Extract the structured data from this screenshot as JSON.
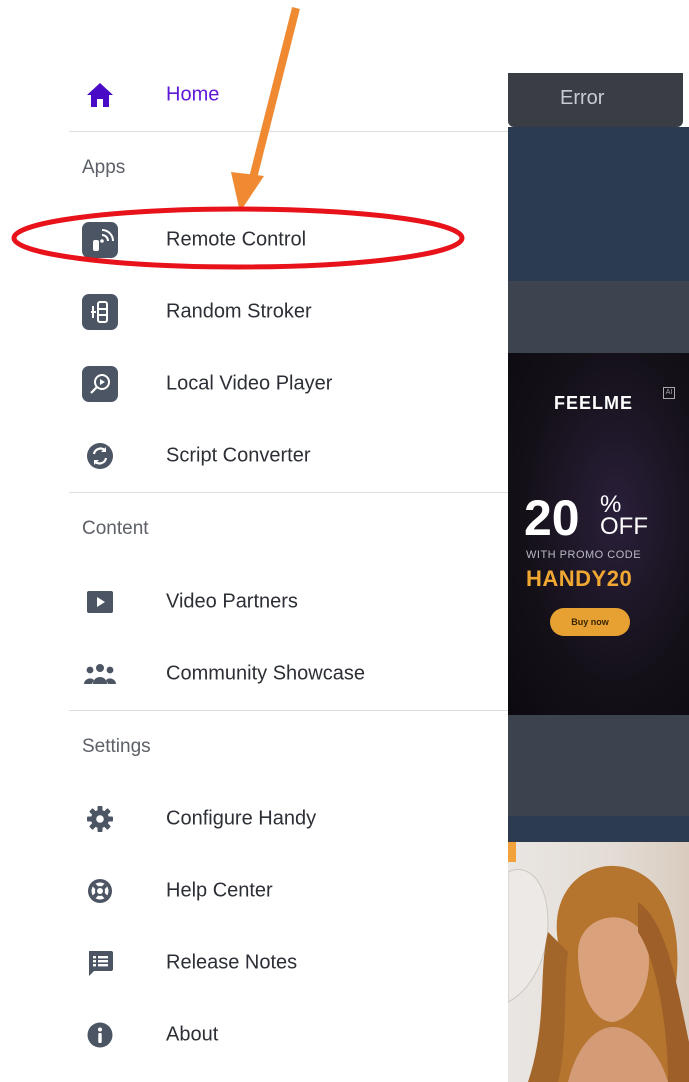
{
  "background": {
    "error_label": "Error",
    "ad": {
      "brand": "FEELME",
      "ai_badge": "AI",
      "percent": "20",
      "percent_sign": "%",
      "off": "OFF",
      "promo_text": "WITH PROMO CODE",
      "promo_code": "HANDY20",
      "buy_label": "Buy now"
    }
  },
  "drawer": {
    "home": {
      "label": "Home",
      "icon": "home-icon"
    },
    "sections": [
      {
        "title": "Apps",
        "items": [
          {
            "label": "Remote Control",
            "icon": "remote-control-icon"
          },
          {
            "label": "Random Stroker",
            "icon": "random-stroker-icon"
          },
          {
            "label": "Local Video Player",
            "icon": "local-video-player-icon"
          },
          {
            "label": "Script Converter",
            "icon": "script-converter-icon"
          }
        ]
      },
      {
        "title": "Content",
        "items": [
          {
            "label": "Video Partners",
            "icon": "play-icon"
          },
          {
            "label": "Community Showcase",
            "icon": "community-icon"
          }
        ]
      },
      {
        "title": "Settings",
        "items": [
          {
            "label": "Configure Handy",
            "icon": "gear-icon"
          },
          {
            "label": "Help Center",
            "icon": "lifebuoy-icon"
          },
          {
            "label": "Release Notes",
            "icon": "release-notes-icon"
          },
          {
            "label": "About",
            "icon": "info-icon"
          }
        ]
      }
    ]
  },
  "colors": {
    "accent": "#5f17d8",
    "annotation_arrow": "#f08a32",
    "annotation_circle": "#e8121a",
    "icon_tile": "#4b5563"
  }
}
